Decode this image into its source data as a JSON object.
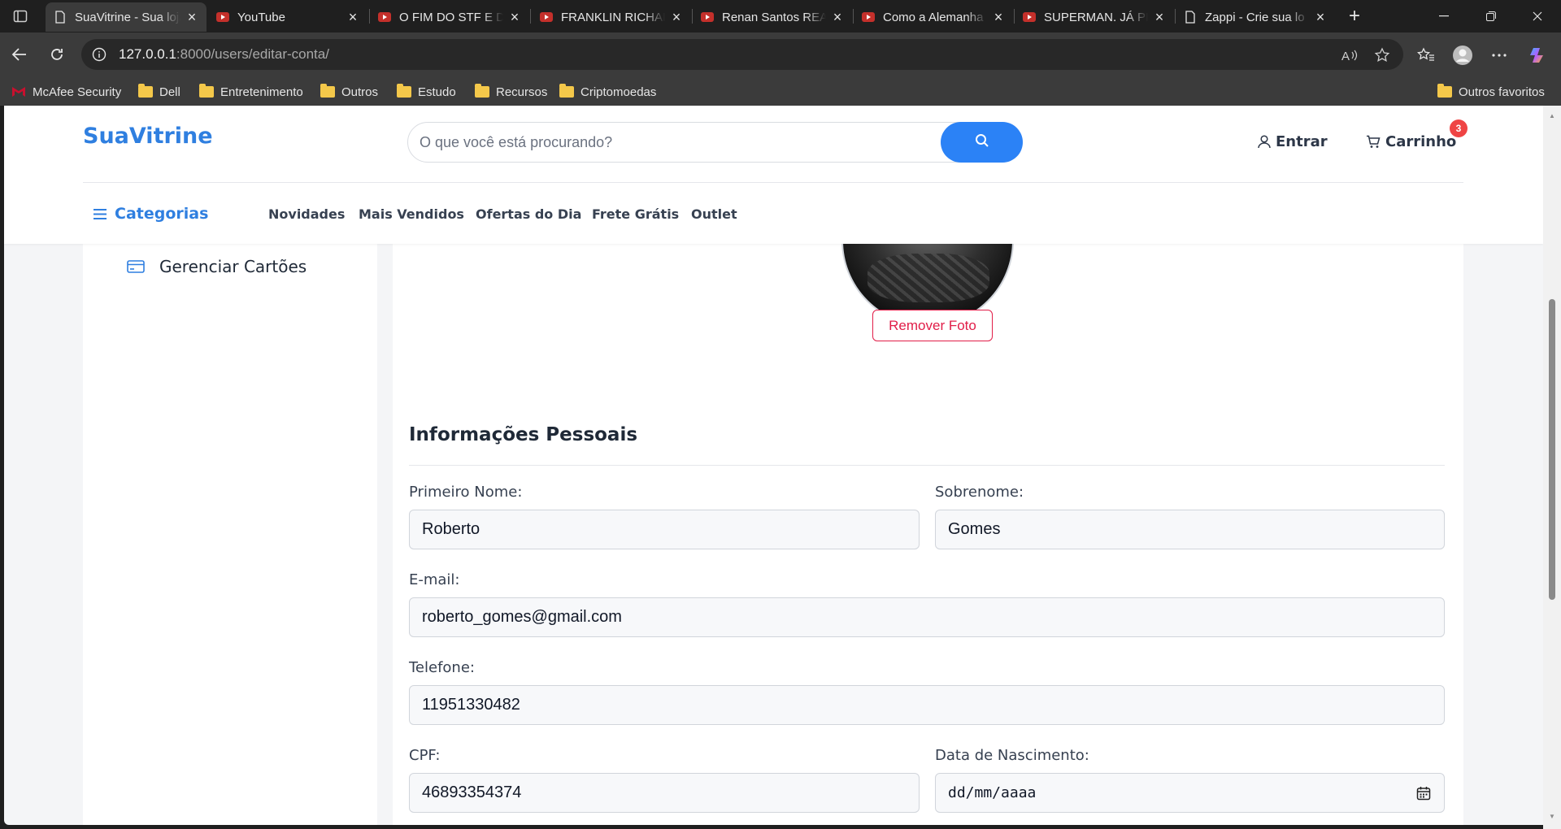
{
  "browser": {
    "tabs": [
      {
        "title": "SuaVitrine - Sua loja",
        "icon": "page-icon",
        "active": true
      },
      {
        "title": "YouTube",
        "icon": "youtube-icon"
      },
      {
        "title": "O FIM DO STF E DE",
        "icon": "youtube-icon"
      },
      {
        "title": "FRANKLIN RICHARD",
        "icon": "youtube-icon"
      },
      {
        "title": "Renan Santos REA",
        "icon": "youtube-icon"
      },
      {
        "title": "Como a Alemanha",
        "icon": "youtube-icon"
      },
      {
        "title": "SUPERMAN. JÁ PEN",
        "icon": "youtube-icon"
      },
      {
        "title": "Zappi - Crie sua lo",
        "icon": "page-icon"
      }
    ],
    "url_host": "127.0.0.1",
    "url_rest": ":8000/users/editar-conta/",
    "bookmarks": [
      "McAfee Security",
      "Dell",
      "Entretenimento",
      "Outros",
      "Estudo",
      "Recursos",
      "Criptomoedas"
    ],
    "other_bookmarks": "Outros favoritos"
  },
  "site": {
    "brand": "SuaVitrine",
    "search_placeholder": "O que você está procurando?",
    "login_label": "Entrar",
    "cart_label": "Carrinho",
    "cart_count": "3",
    "categories_label": "Categorias",
    "menu": [
      "Novidades",
      "Mais Vendidos",
      "Ofertas do Dia",
      "Frete Grátis",
      "Outlet"
    ],
    "brand_color": "#2f7fe0",
    "accent_color": "#2b82f6",
    "danger_color": "#e11d48"
  },
  "sidebar": {
    "manage_cards": "Gerenciar Cartões"
  },
  "profile": {
    "remove_photo": "Remover Foto",
    "section_title": "Informações Pessoais",
    "first_name_label": "Primeiro Nome:",
    "first_name": "Roberto",
    "last_name_label": "Sobrenome:",
    "last_name": "Gomes",
    "email_label": "E-mail:",
    "email": "roberto_gomes@gmail.com",
    "phone_label": "Telefone:",
    "phone": "11951330482",
    "cpf_label": "CPF:",
    "cpf": "46893354374",
    "birth_label": "Data de Nascimento:",
    "birth_placeholder": "dd/mm/aaaa"
  }
}
